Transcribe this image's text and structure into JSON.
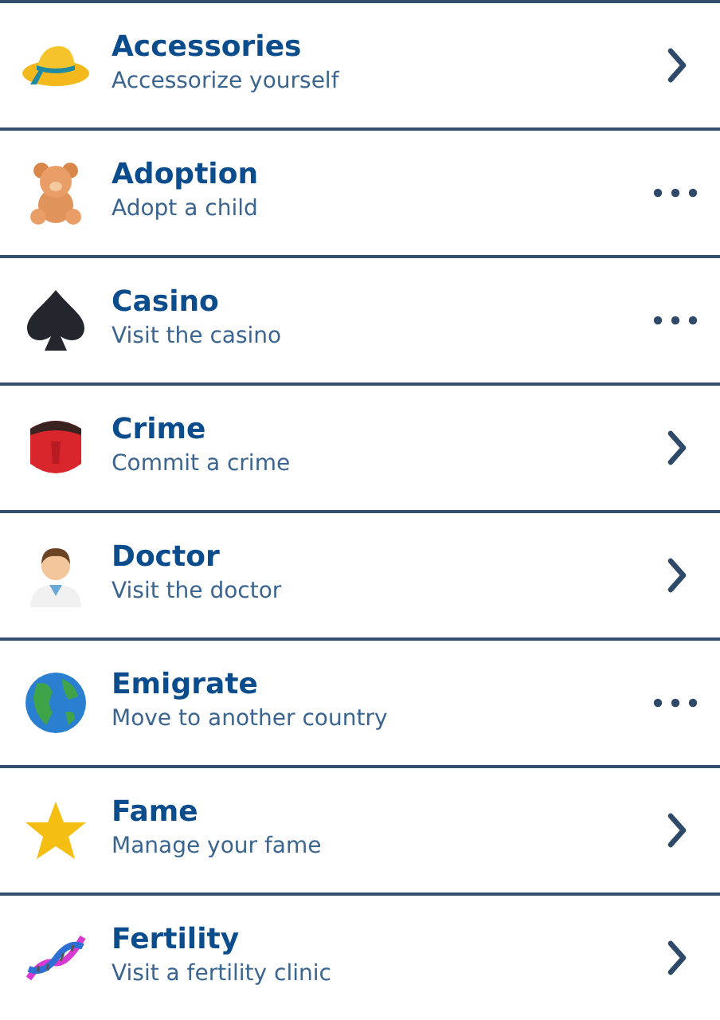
{
  "items": [
    {
      "title": "Accessories",
      "subtitle": "Accessorize yourself",
      "kind": "chevron"
    },
    {
      "title": "Adoption",
      "subtitle": "Adopt a child",
      "kind": "more"
    },
    {
      "title": "Casino",
      "subtitle": "Visit the casino",
      "kind": "more"
    },
    {
      "title": "Crime",
      "subtitle": "Commit a crime",
      "kind": "chevron"
    },
    {
      "title": "Doctor",
      "subtitle": "Visit the doctor",
      "kind": "chevron"
    },
    {
      "title": "Emigrate",
      "subtitle": "Move to another country",
      "kind": "more"
    },
    {
      "title": "Fame",
      "subtitle": "Manage your fame",
      "kind": "chevron"
    },
    {
      "title": "Fertility",
      "subtitle": "Visit a fertility clinic",
      "kind": "chevron"
    }
  ]
}
